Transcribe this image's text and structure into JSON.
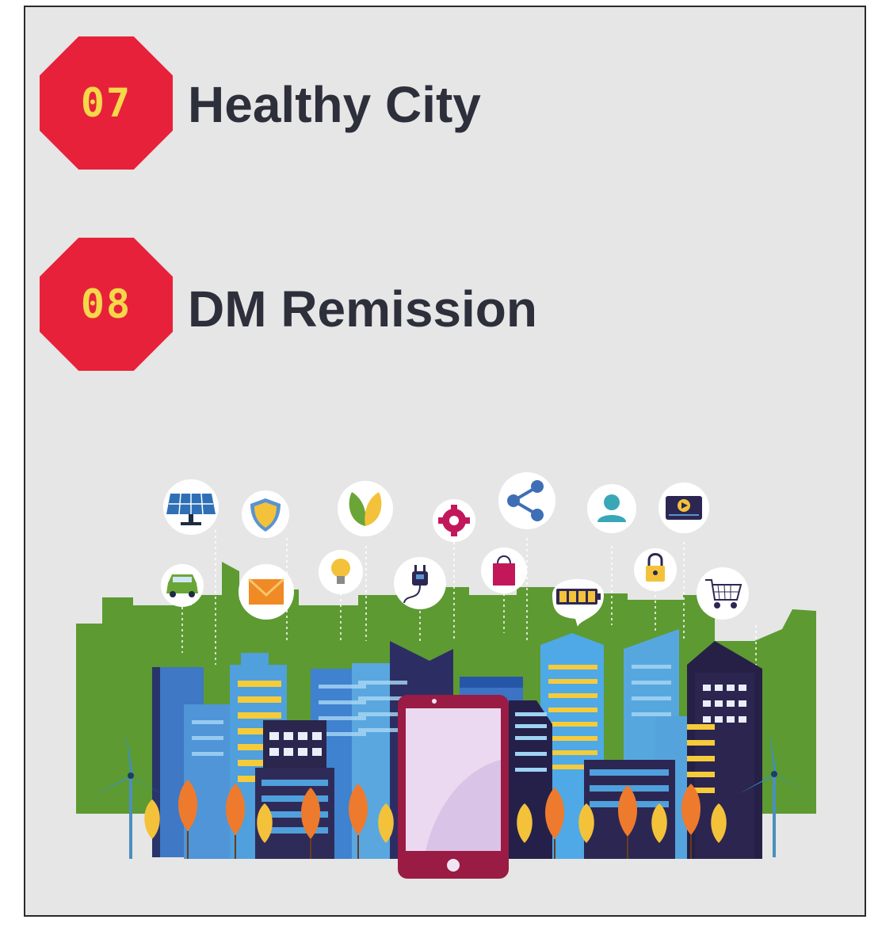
{
  "colors": {
    "badge_fill": "#e8213b",
    "badge_text": "#f5d84a",
    "heading_text": "#2d2f3b",
    "panel_bg": "#e6e6e6",
    "green_hills": "#5d9a32"
  },
  "items": [
    {
      "number": "07",
      "title": "Healthy City"
    },
    {
      "number": "08",
      "title": "DM Remission"
    }
  ],
  "illustration": {
    "icons": [
      "solar-panel-icon",
      "shield-icon",
      "leaf-icon",
      "gear-icon",
      "share-icon",
      "user-icon",
      "video-player-icon",
      "car-icon",
      "mail-icon",
      "lightbulb-icon",
      "plug-icon",
      "shopping-bag-icon",
      "battery-icon",
      "lock-icon",
      "cart-icon"
    ]
  }
}
